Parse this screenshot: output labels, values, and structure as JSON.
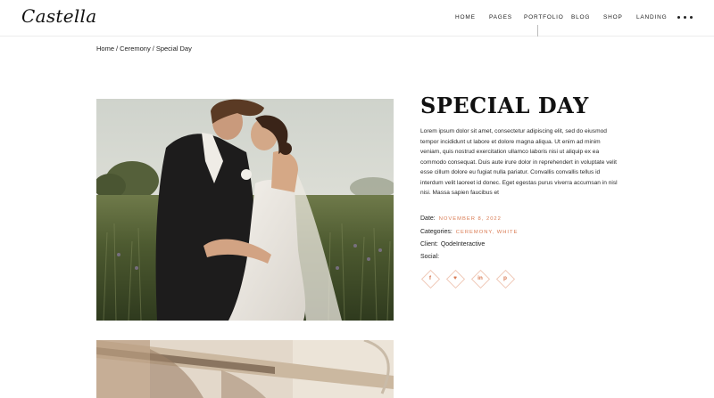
{
  "header": {
    "logo": "Castella",
    "nav": [
      "HOME",
      "PAGES",
      "PORTFOLIO",
      "BLOG",
      "SHOP",
      "LANDING"
    ]
  },
  "breadcrumb": {
    "items": [
      "Home",
      "Ceremony",
      "Special Day"
    ],
    "separator": "/"
  },
  "project": {
    "title": "SPECIAL DAY",
    "description": "Lorem ipsum dolor sit amet, consectetur adipiscing elit, sed do eiusmod tempor incididunt ut labore et dolore magna aliqua. Ut enim ad minim veniam, quis nostrud exercitation ullamco laboris nisi ut aliquip ex ea commodo consequat. Duis aute irure dolor in reprehendert in voluptate velit esse cillum dolore eu fugiat nulla pariatur. Convallis convallis tellus id interdum velit laoreet id donec. Eget egestas purus viverra accumsan in nisl nisi. Massa sapien faucibus et",
    "date_label": "Date:",
    "date_value": "November 8, 2022",
    "categories_label": "Categories:",
    "categories_value": "Ceremony, White",
    "client_label": "Client:",
    "client_value": "QodeInteractive",
    "social_label": "Social:"
  },
  "social_icons": [
    "facebook-icon",
    "twitter-icon",
    "linkedin-icon",
    "pinterest-icon"
  ],
  "social_glyphs": [
    "f",
    "♥",
    "in",
    "p"
  ],
  "colors": {
    "accent": "#d97a52",
    "diamond_border": "#f0c9b8",
    "text": "#1a1a1a"
  }
}
